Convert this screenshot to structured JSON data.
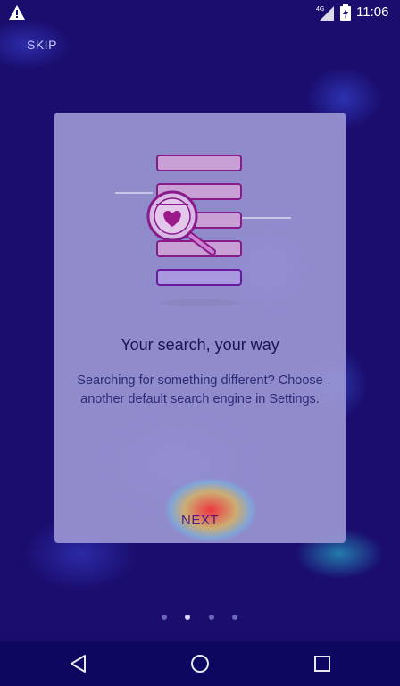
{
  "status_bar": {
    "time": "11:06",
    "network_type": "4G",
    "icons": [
      "warning-icon",
      "signal-icon",
      "battery-charging-icon"
    ]
  },
  "skip_label": "SKIP",
  "card": {
    "title": "Your search, your way",
    "description": "Searching for something different? Choose another default search engine in Settings.",
    "next_label": "NEXT",
    "illustration": "search-magnifier-heart-icon"
  },
  "pager": {
    "total": 4,
    "current": 2
  },
  "nav_bar": {
    "buttons": [
      "back-icon",
      "home-icon",
      "recents-icon"
    ]
  },
  "colors": {
    "background": "#1a0d6e",
    "card": "#9a96d2",
    "accent": "#9a1a8a"
  }
}
